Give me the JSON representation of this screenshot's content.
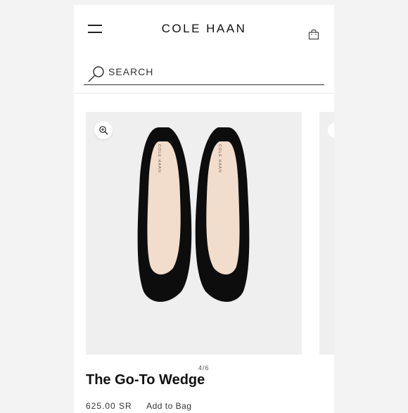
{
  "header": {
    "brand": "COLE HAAN",
    "menu_icon": "hamburger-menu-icon",
    "bag_icon": "shopping-bag-icon"
  },
  "search": {
    "label": "SEARCH",
    "icon": "search-icon"
  },
  "product": {
    "image_counter": "4/6",
    "name": "The Go-To Wedge",
    "price": "625.00 SR",
    "add_to_bag": "Add to Bag",
    "zoom_icon": "zoom-in-icon",
    "insole_brand": "COLE HAAN"
  },
  "colors": {
    "background": "#f3f3f3",
    "card": "#efefef",
    "shoe": "#0d0d0d",
    "insole": "#f2dccb"
  }
}
